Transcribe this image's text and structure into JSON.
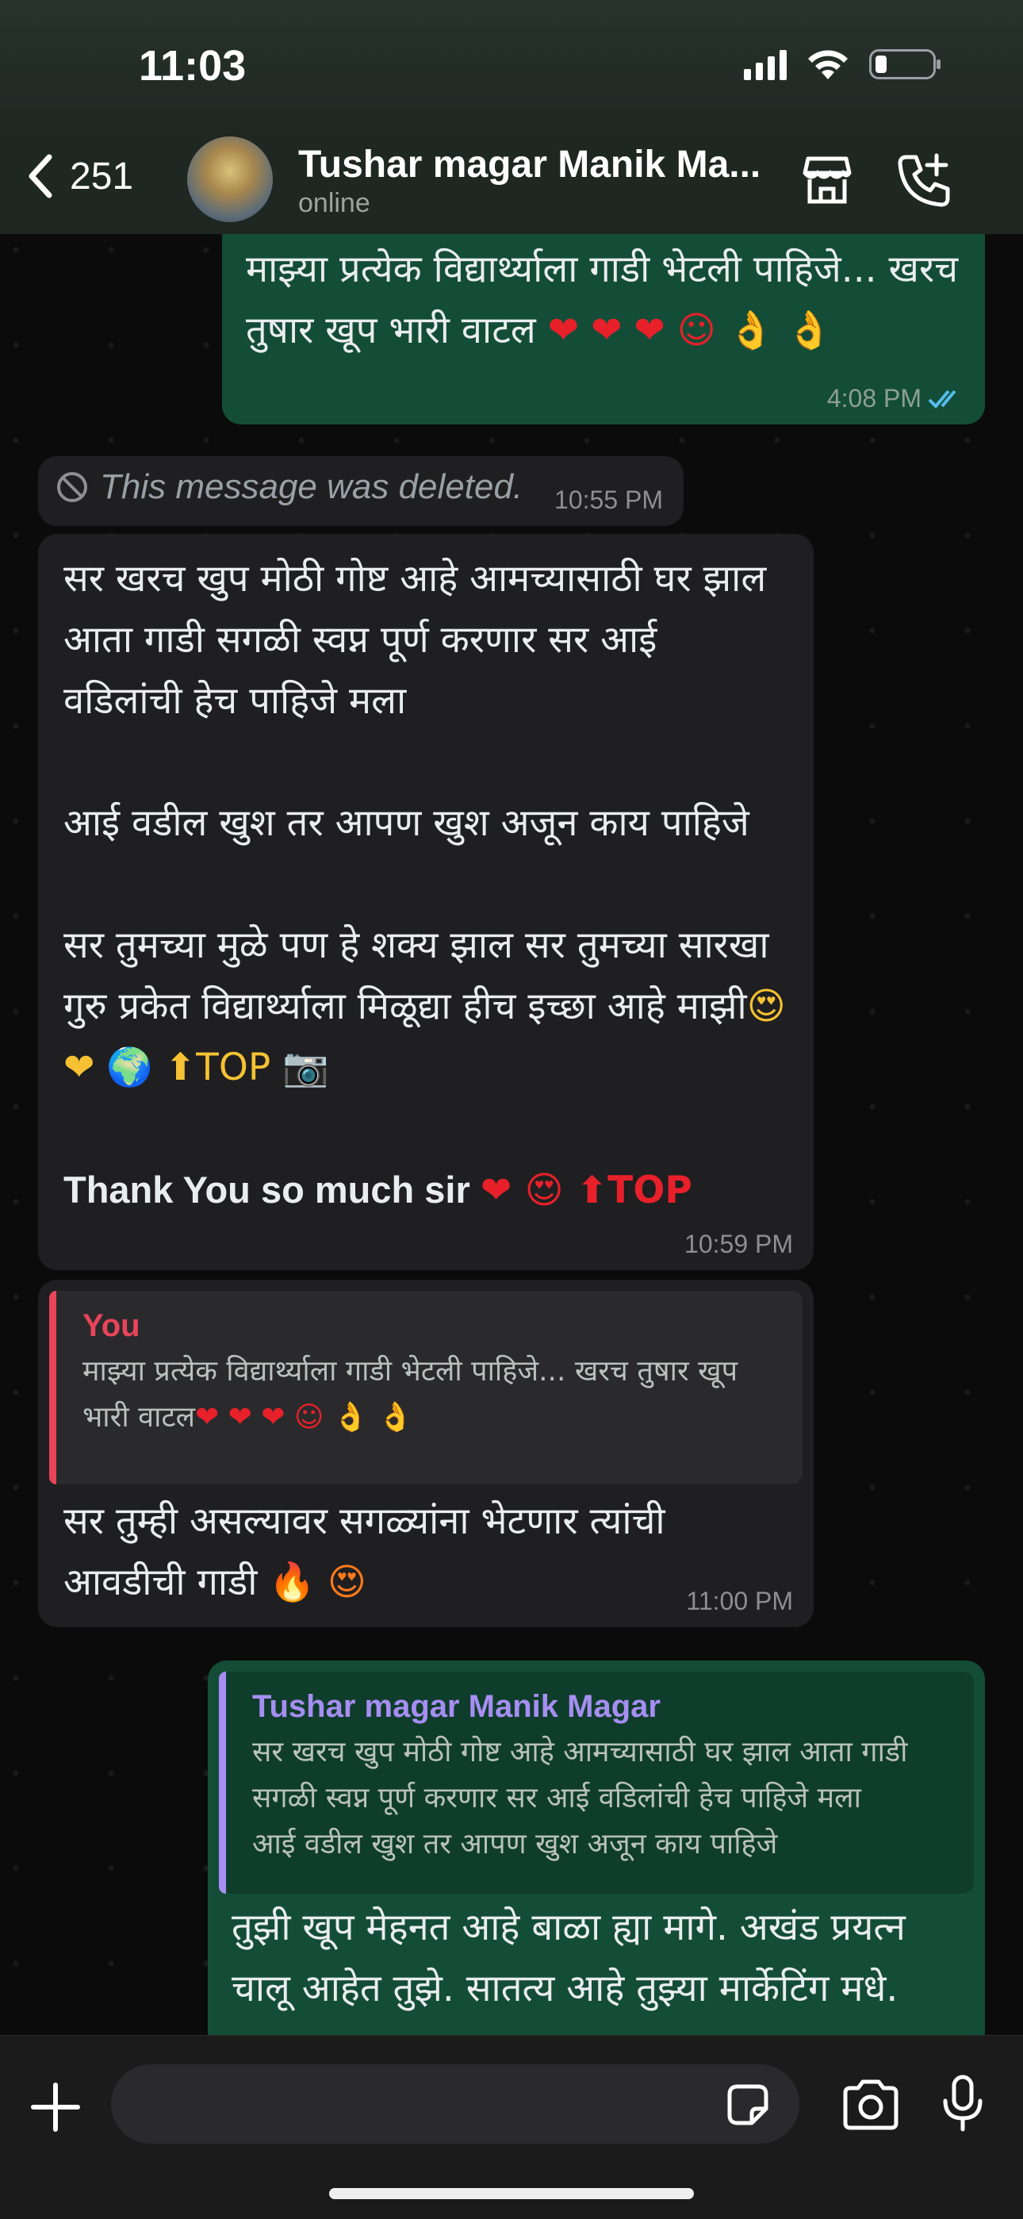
{
  "status": {
    "time": "11:03"
  },
  "header": {
    "back_count": "251",
    "contact_name": "Tushar magar Manik Ma...",
    "contact_status": "online"
  },
  "messages": [
    {
      "direction": "outgoing",
      "text": "माझ्या प्रत्येक विद्यार्थ्याला गाडी भेटली पाहिजे... खरच तुषार खूप भारी वाटल",
      "emojis": "❤ ❤ ❤ ☺ 👌 👌",
      "time": "4:08 PM",
      "read_receipt": "double-check-blue"
    },
    {
      "direction": "incoming",
      "deleted": true,
      "text": "This message was deleted.",
      "time": "10:55 PM"
    },
    {
      "direction": "incoming",
      "paragraph_1": "सर खरच खुप मोठी गोष्ट आहे आमच्यासाठी घर झाल आता गाडी सगळी स्वप्न पूर्ण करणार सर आई वडिलांची हेच पाहिजे मला",
      "paragraph_2": "आई वडील खुश तर आपण खुश अजून काय पाहिजे",
      "paragraph_3": "सर तुमच्या मुळे पण हे शक्य झाल सर तुमच्या सारखा गुरु प्रकेत विद्यार्थ्याला मिळूद्या हीच इच्छा आहे माझी",
      "paragraph_3_emojis": "😍 ❤ 🌍 ⬆TOP 📷",
      "paragraph_4": "Thank You so much sir",
      "paragraph_4_emojis": "❤ 😍 ⬆TOP",
      "time": "10:59 PM"
    },
    {
      "direction": "incoming",
      "quote_author": "You",
      "quote_text": "माझ्या प्रत्येक विद्यार्थ्याला गाडी भेटली पाहिजे... खरच तुषार खूप भारी वाटल",
      "quote_emojis": "❤ ❤ ❤ ☺ 👌 👌",
      "text": "सर तुम्ही असल्यावर सगळ्यांना भेटणार त्यांची आवडीची गाडी",
      "emojis": "🔥 😍",
      "time": "11:00 PM"
    },
    {
      "direction": "outgoing",
      "quote_author": "Tushar magar Manik Magar",
      "quote_text": "सर खरच खुप मोठी गोष्ट आहे आमच्यासाठी घर झाल आता गाडी सगळी स्वप्न पूर्ण करणार सर आई वडिलांची हेच पाहिजे मला\nआई वडील खुश तर आपण खुश अजून काय पाहिजे",
      "text": "तुझी खूप मेहनत आहे बाळा ह्या मागे. अखंड प्रयत्न चालू आहेत तुझे. सातत्य आहे तुझ्या मार्केटिंग मधे."
    }
  ],
  "colors": {
    "outgoing_bubble": "#144d37",
    "incoming_bubble": "#1f1f21",
    "quote_you": "#e9445a",
    "quote_contact": "#a68ef2"
  },
  "icons": [
    "back-chevron-icon",
    "store-icon",
    "add-call-icon",
    "plus-icon",
    "sticker-icon",
    "camera-icon",
    "microphone-icon"
  ]
}
